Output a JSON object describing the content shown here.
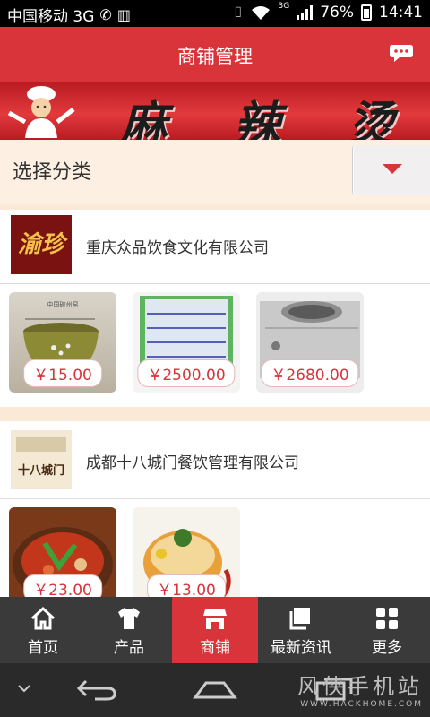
{
  "status_bar": {
    "carrier": "中国移动 3G",
    "network": "3G",
    "battery": "76%",
    "time": "14:41"
  },
  "header": {
    "title": "商铺管理"
  },
  "banner": {
    "text": [
      "麻",
      "辣",
      "烫"
    ]
  },
  "category": {
    "label": "选择分类"
  },
  "companies": [
    {
      "name": "重庆众品饮食文化有限公司",
      "logo_text": "渝珍",
      "products": [
        {
          "kind": "bowl-image",
          "price": "￥15.00"
        },
        {
          "kind": "display-fridge-image",
          "price": "￥2500.00"
        },
        {
          "kind": "stove-image",
          "price": "￥2680.00"
        }
      ]
    },
    {
      "name": "成都十八城门餐饮管理有限公司",
      "logo_text": "十八城门",
      "products": [
        {
          "kind": "hotpot-dish-image",
          "price": "￥23.00"
        },
        {
          "kind": "noodle-bowl-image",
          "price": "￥13.00"
        }
      ]
    }
  ],
  "bottom_nav": [
    {
      "label": "首页",
      "icon": "home-icon",
      "active": false
    },
    {
      "label": "产品",
      "icon": "shirt-icon",
      "active": false
    },
    {
      "label": "商铺",
      "icon": "store-icon",
      "active": true
    },
    {
      "label": "最新资讯",
      "icon": "news-icon",
      "active": false
    },
    {
      "label": "更多",
      "icon": "grid-icon",
      "active": false
    }
  ],
  "watermark": {
    "title": "风侠手机站",
    "url": "WWW.HACKHOME.COM"
  },
  "colors": {
    "accent": "#d8343a",
    "nav_bg": "#3a3a3a"
  }
}
